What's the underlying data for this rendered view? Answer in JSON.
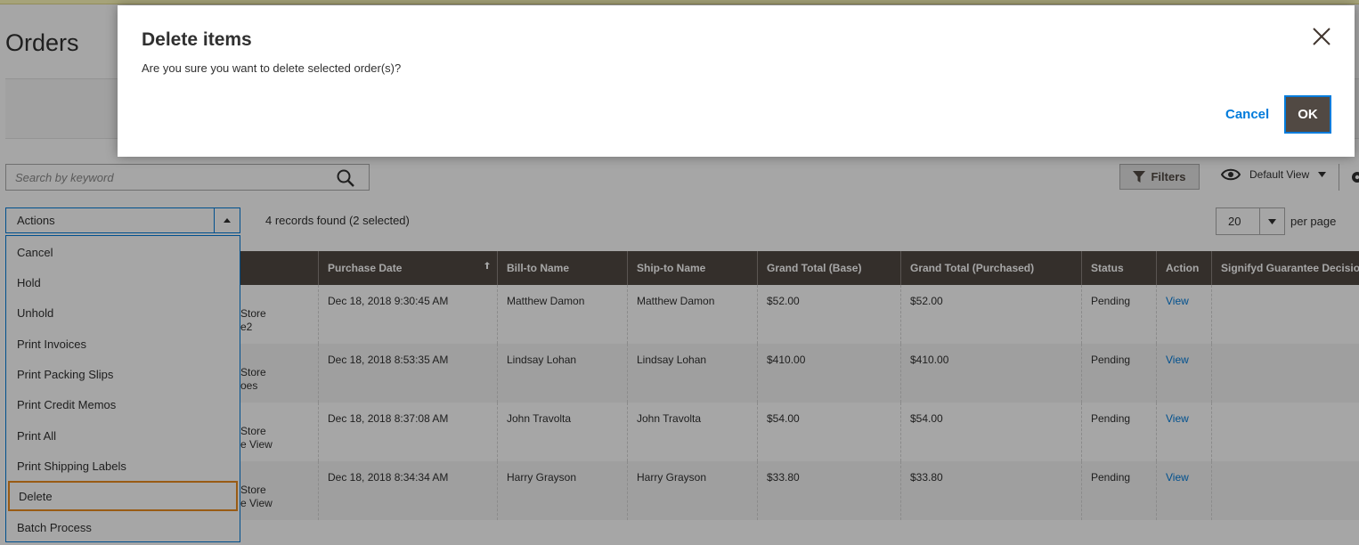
{
  "page": {
    "title": "Orders"
  },
  "search": {
    "placeholder": "Search by keyword"
  },
  "toolbar": {
    "filters_label": "Filters",
    "view_label": "Default View",
    "actions_label": "Actions",
    "records_text": "4 records found (2 selected)",
    "per_page_value": "20",
    "per_page_label": "per page"
  },
  "actions_menu": [
    {
      "label": "Cancel"
    },
    {
      "label": "Hold"
    },
    {
      "label": "Unhold"
    },
    {
      "label": "Print Invoices"
    },
    {
      "label": "Print Packing Slips"
    },
    {
      "label": "Print Credit Memos"
    },
    {
      "label": "Print All"
    },
    {
      "label": "Print Shipping Labels"
    },
    {
      "label": "Delete",
      "highlighted": true
    },
    {
      "label": "Batch Process"
    }
  ],
  "grid": {
    "columns": [
      "Purchase Date",
      "Bill-to Name",
      "Ship-to Name",
      "Grand Total (Base)",
      "Grand Total (Purchased)",
      "Status",
      "Action",
      "Signifyd Guarantee Decision"
    ],
    "rows": [
      {
        "store1": "Store",
        "store2": "e2",
        "date": "Dec 18, 2018 9:30:45 AM",
        "bill": "Matthew Damon",
        "ship": "Matthew Damon",
        "base": "$52.00",
        "purchased": "$52.00",
        "status": "Pending",
        "action": "View"
      },
      {
        "store1": "Store",
        "store2": "oes",
        "date": "Dec 18, 2018 8:53:35 AM",
        "bill": "Lindsay Lohan",
        "ship": "Lindsay Lohan",
        "base": "$410.00",
        "purchased": "$410.00",
        "status": "Pending",
        "action": "View"
      },
      {
        "store1": "Store",
        "store2": "e View",
        "date": "Dec 18, 2018 8:37:08 AM",
        "bill": "John Travolta",
        "ship": "John Travolta",
        "base": "$54.00",
        "purchased": "$54.00",
        "status": "Pending",
        "action": "View"
      },
      {
        "store1": "Store",
        "store2": "e View",
        "date": "Dec 18, 2018 8:34:34 AM",
        "bill": "Harry Grayson",
        "ship": "Harry Grayson",
        "base": "$33.80",
        "purchased": "$33.80",
        "status": "Pending",
        "action": "View"
      }
    ]
  },
  "modal": {
    "title": "Delete items",
    "message": "Are you sure you want to delete selected order(s)?",
    "cancel_label": "Cancel",
    "ok_label": "OK"
  },
  "colors": {
    "accent": "#007bdb",
    "header_bg": "#514943",
    "highlight_border": "#eb8c1f"
  }
}
